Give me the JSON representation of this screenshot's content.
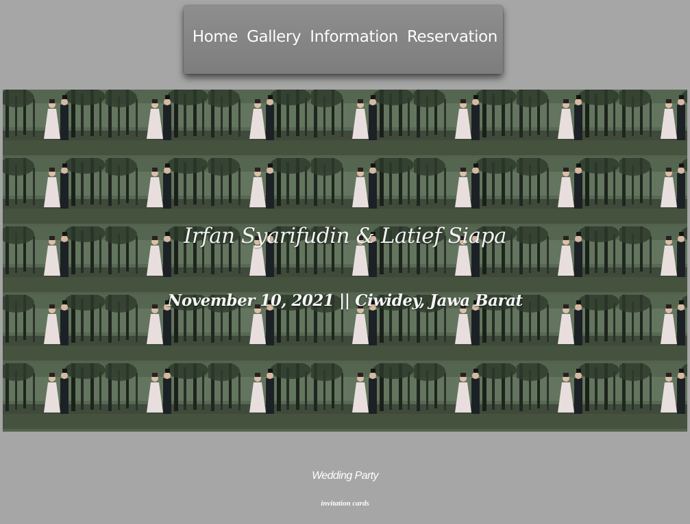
{
  "nav": {
    "items": [
      {
        "label": "Home"
      },
      {
        "label": "Gallery"
      },
      {
        "label": "Information"
      },
      {
        "label": "Reservation"
      }
    ]
  },
  "hero": {
    "title": "Irfan Syarifudin & Latief Siapa",
    "subtitle": "November 10, 2021 || Ciwidey, Jawa Barat",
    "image": "tiled-wedding-couple-forest-photo"
  },
  "footer": {
    "title": "Wedding Party",
    "subtitle": "invitation cards"
  },
  "colors": {
    "page_background": "#a6a6a6",
    "navbar_background": "#868686",
    "text": "#ffffff"
  }
}
